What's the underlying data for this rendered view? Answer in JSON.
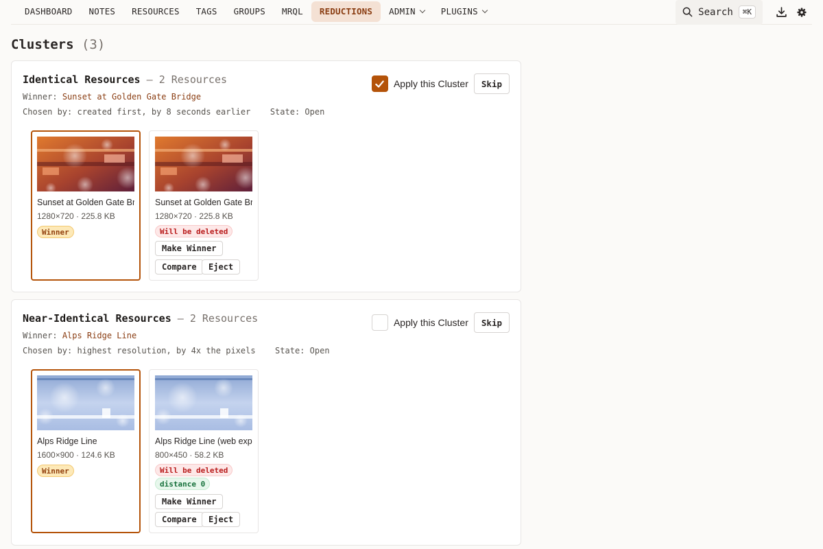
{
  "nav": {
    "items": [
      {
        "label": "DASHBOARD"
      },
      {
        "label": "NOTES"
      },
      {
        "label": "RESOURCES"
      },
      {
        "label": "TAGS"
      },
      {
        "label": "GROUPS"
      },
      {
        "label": "MRQL"
      },
      {
        "label": "REDUCTIONS",
        "active": true
      },
      {
        "label": "ADMIN",
        "dropdown": true
      },
      {
        "label": "PLUGINS",
        "dropdown": true
      }
    ],
    "search_label": "Search",
    "search_shortcut": "⌘K"
  },
  "page": {
    "title": "Clusters",
    "count": "(3)"
  },
  "clusters": [
    {
      "title": "Identical Resources",
      "separator": "—",
      "resource_count": "2 Resources",
      "winner_label": "Winner:",
      "winner_name": "Sunset at Golden Gate Bridge",
      "chosen_label": "Chosen by:",
      "chosen_value": "created first, by 8 seconds earlier",
      "state_label": "State:",
      "state_value": "Open",
      "apply_checked": true,
      "apply_label": "Apply this Cluster",
      "skip_label": "Skip",
      "resources": [
        {
          "name": "Sunset at Golden Gate Bridge",
          "size": "1280×720 · 225.8 KB",
          "badge": "Winner"
        },
        {
          "name": "Sunset at Golden Gate Bridge",
          "size": "1280×720 · 225.8 KB",
          "badge": "Will be deleted",
          "make_winner": "Make Winner",
          "compare": "Compare",
          "eject": "Eject"
        }
      ]
    },
    {
      "title": "Near-Identical Resources",
      "separator": "—",
      "resource_count": "2 Resources",
      "winner_label": "Winner:",
      "winner_name": "Alps Ridge Line",
      "chosen_label": "Chosen by:",
      "chosen_value": "highest resolution, by 4x the pixels",
      "state_label": "State:",
      "state_value": "Open",
      "apply_checked": false,
      "apply_label": "Apply this Cluster",
      "skip_label": "Skip",
      "resources": [
        {
          "name": "Alps Ridge Line",
          "size": "1600×900 · 124.6 KB",
          "badge": "Winner"
        },
        {
          "name": "Alps Ridge Line (web export)",
          "size": "800×450 · 58.2 KB",
          "badge": "Will be deleted",
          "distance": "distance 0",
          "make_winner": "Make Winner",
          "compare": "Compare",
          "eject": "Eject"
        }
      ]
    }
  ],
  "colors": {
    "accent": "#b45309",
    "active_nav_bg": "#f4e1d4",
    "winner_badge_bg": "#fde9b8",
    "delete_badge_bg": "#fde8e8",
    "distance_badge_bg": "#e7f7ec"
  }
}
